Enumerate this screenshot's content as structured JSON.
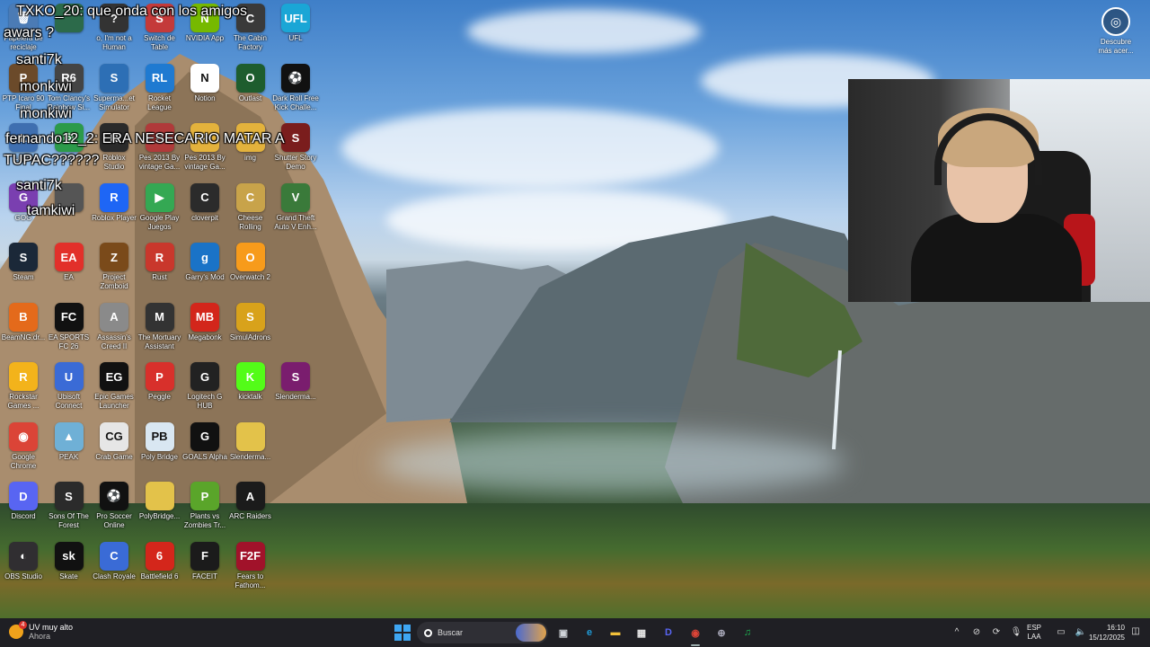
{
  "desktop": {
    "icons": [
      {
        "label": "Papelera de\nreciclaje",
        "color": "#4b7bb5",
        "glyph": "🗑"
      },
      {
        "label": "",
        "color": "#2c6a4a",
        "glyph": ""
      },
      {
        "label": "o, I'm not a\nHuman",
        "color": "#333",
        "glyph": "?"
      },
      {
        "label": "Switch de\nTable",
        "color": "#c43a3a",
        "glyph": "S"
      },
      {
        "label": "NVIDIA App",
        "color": "#76b900",
        "glyph": "N"
      },
      {
        "label": "The Cabin\nFactory",
        "color": "#3a3a3a",
        "glyph": "C"
      },
      {
        "label": "UFL",
        "color": "#1aa6d6",
        "glyph": "UFL"
      },
      {
        "label": "PTP Icaro 90\nFinal",
        "color": "#6b4a2a",
        "glyph": "P"
      },
      {
        "label": "Tom Clancy's\nRainbow Si...",
        "color": "#444",
        "glyph": "R6"
      },
      {
        "label": "Superma...et\nSimulator",
        "color": "#2d6fb5",
        "glyph": "S"
      },
      {
        "label": "Rocket\nLeague",
        "color": "#1f7ad1",
        "glyph": "RL"
      },
      {
        "label": "Notion",
        "color": "#ffffff",
        "glyph": "N"
      },
      {
        "label": "Outlast",
        "color": "#1e5d2e",
        "glyph": "O"
      },
      {
        "label": "Dark Roll Free\nKick Challe...",
        "color": "#111",
        "glyph": "⚽"
      },
      {
        "label": "Lugar",
        "color": "#3f6fb0",
        "glyph": "L"
      },
      {
        "label": "App",
        "color": "#2c9a4a",
        "glyph": "◎"
      },
      {
        "label": "Roblox\nStudio",
        "color": "#2a2a2a",
        "glyph": "R"
      },
      {
        "label": "Pes 2013 By\nvintage Ga...",
        "color": "#b03a3a",
        "glyph": "P"
      },
      {
        "label": "Pes 2013 By\nvintage Ga...",
        "color": "#e3b23c",
        "glyph": "P"
      },
      {
        "label": "img",
        "color": "#e3b23c",
        "glyph": ""
      },
      {
        "label": "Shutter Story\nDemo",
        "color": "#7a1d1d",
        "glyph": "S"
      },
      {
        "label": "GOG",
        "color": "#7a3fb0",
        "glyph": "G"
      },
      {
        "label": "",
        "color": "#555",
        "glyph": ""
      },
      {
        "label": "Roblox Player",
        "color": "#1e66f5",
        "glyph": "R"
      },
      {
        "label": "Google Play\nJuegos",
        "color": "#34a853",
        "glyph": "▶"
      },
      {
        "label": "cloverpit",
        "color": "#2b2b2b",
        "glyph": "C"
      },
      {
        "label": "Cheese\nRolling",
        "color": "#c8a34a",
        "glyph": "C"
      },
      {
        "label": "Grand Theft\nAuto V Enh...",
        "color": "#3a7a3a",
        "glyph": "V"
      },
      {
        "label": "Steam",
        "color": "#1b2838",
        "glyph": "S"
      },
      {
        "label": "EA",
        "color": "#e2302a",
        "glyph": "EA"
      },
      {
        "label": "Project\nZomboid",
        "color": "#7a4a1a",
        "glyph": "Z"
      },
      {
        "label": "Rust",
        "color": "#c9372c",
        "glyph": "R"
      },
      {
        "label": "Garry's Mod",
        "color": "#1a73c7",
        "glyph": "g"
      },
      {
        "label": "Overwatch 2",
        "color": "#f79b1b",
        "glyph": "O"
      },
      {
        "label": "",
        "color": "transparent",
        "glyph": ""
      },
      {
        "label": "BeamNG.dr...",
        "color": "#e46a1b",
        "glyph": "B"
      },
      {
        "label": "EA SPORTS\nFC 26",
        "color": "#111",
        "glyph": "FC"
      },
      {
        "label": "Assassin's\nCreed II",
        "color": "#8a8a8a",
        "glyph": "A"
      },
      {
        "label": "The Mortuary\nAssistant",
        "color": "#333",
        "glyph": "M"
      },
      {
        "label": "Megabonk",
        "color": "#d3261b",
        "glyph": "MB"
      },
      {
        "label": "SimulAdrons",
        "color": "#d8a21b",
        "glyph": "S"
      },
      {
        "label": "",
        "color": "transparent",
        "glyph": ""
      },
      {
        "label": "Rockstar\nGames ...",
        "color": "#f3b31b",
        "glyph": "R"
      },
      {
        "label": "Ubisoft\nConnect",
        "color": "#3a6bd6",
        "glyph": "U"
      },
      {
        "label": "Epic Games\nLauncher",
        "color": "#111",
        "glyph": "EG"
      },
      {
        "label": "Peggle",
        "color": "#d8302b",
        "glyph": "P"
      },
      {
        "label": "Logitech G\nHUB",
        "color": "#222",
        "glyph": "G"
      },
      {
        "label": "kicktalk",
        "color": "#53fc18",
        "glyph": "K"
      },
      {
        "label": "Slenderma...",
        "color": "#7a1d6e",
        "glyph": "S"
      },
      {
        "label": "Google\nChrome",
        "color": "#db4437",
        "glyph": "◉"
      },
      {
        "label": "PEAK",
        "color": "#6fb0d6",
        "glyph": "▲"
      },
      {
        "label": "Crab Game",
        "color": "#e6e6e6",
        "glyph": "CG"
      },
      {
        "label": "Poly Bridge",
        "color": "#d9e7f2",
        "glyph": "PB"
      },
      {
        "label": "GOALS Alpha",
        "color": "#111",
        "glyph": "G"
      },
      {
        "label": "Slenderma...",
        "color": "#e3c24a",
        "glyph": ""
      },
      {
        "label": "",
        "color": "transparent",
        "glyph": ""
      },
      {
        "label": "Discord",
        "color": "#5865f2",
        "glyph": "D"
      },
      {
        "label": "Sons Of The\nForest",
        "color": "#2b2b2b",
        "glyph": "S"
      },
      {
        "label": "Pro Soccer\nOnline",
        "color": "#111",
        "glyph": "⚽"
      },
      {
        "label": "PolyBridge...",
        "color": "#e3c24a",
        "glyph": ""
      },
      {
        "label": "Plants vs\nZombies Tr...",
        "color": "#5aa52a",
        "glyph": "P"
      },
      {
        "label": "ARC Raiders",
        "color": "#1b1b1b",
        "glyph": "A"
      },
      {
        "label": "",
        "color": "transparent",
        "glyph": ""
      },
      {
        "label": "OBS Studio",
        "color": "#302e31",
        "glyph": "◐"
      },
      {
        "label": "Skate",
        "color": "#111",
        "glyph": "sk"
      },
      {
        "label": "Clash Royale",
        "color": "#3a6bd6",
        "glyph": "C"
      },
      {
        "label": "Battlefield 6",
        "color": "#d4261b",
        "glyph": "6"
      },
      {
        "label": "FACEIT",
        "color": "#1b1b1b",
        "glyph": "F"
      },
      {
        "label": "Fears to\nFathom...",
        "color": "#a1122a",
        "glyph": "F2F"
      },
      {
        "label": "",
        "color": "transparent",
        "glyph": ""
      }
    ]
  },
  "chat": [
    {
      "text": "TXKO_20: que onda con los amigos"
    },
    {
      "text": "awars ?"
    },
    {
      "text": "santi7k"
    },
    {
      "text": "monkiwi"
    },
    {
      "text": "monkiwi"
    },
    {
      "text": "fernando12_2: ERA NESECARIO MATAR A"
    },
    {
      "text": "TUPAC??????"
    },
    {
      "text": "santi7k"
    },
    {
      "text": "tamkiwi"
    }
  ],
  "widget": {
    "label": "Descubre\nmás acer...",
    "icon": "camera-icon"
  },
  "taskbar": {
    "weather_title": "UV muy alto",
    "weather_sub": "Ahora",
    "weather_badge": "4",
    "search_placeholder": "Buscar",
    "language_line1": "ESP",
    "language_line2": "LAA",
    "time": "16:10",
    "date": "15/12/2025",
    "apps": [
      {
        "name": "task-view",
        "glyph": "▣",
        "color": "#cfd3d8"
      },
      {
        "name": "edge",
        "glyph": "e",
        "color": "#1f9ad6"
      },
      {
        "name": "file-explorer",
        "glyph": "▬",
        "color": "#f2c13a"
      },
      {
        "name": "microsoft-store",
        "glyph": "▦",
        "color": "#e6e6e6"
      },
      {
        "name": "discord",
        "glyph": "D",
        "color": "#5865f2"
      },
      {
        "name": "chrome",
        "glyph": "◉",
        "color": "#db4437"
      },
      {
        "name": "steam-cleaner",
        "glyph": "⊕",
        "color": "#aab"
      },
      {
        "name": "spotify",
        "glyph": "♫",
        "color": "#1db954"
      }
    ]
  }
}
